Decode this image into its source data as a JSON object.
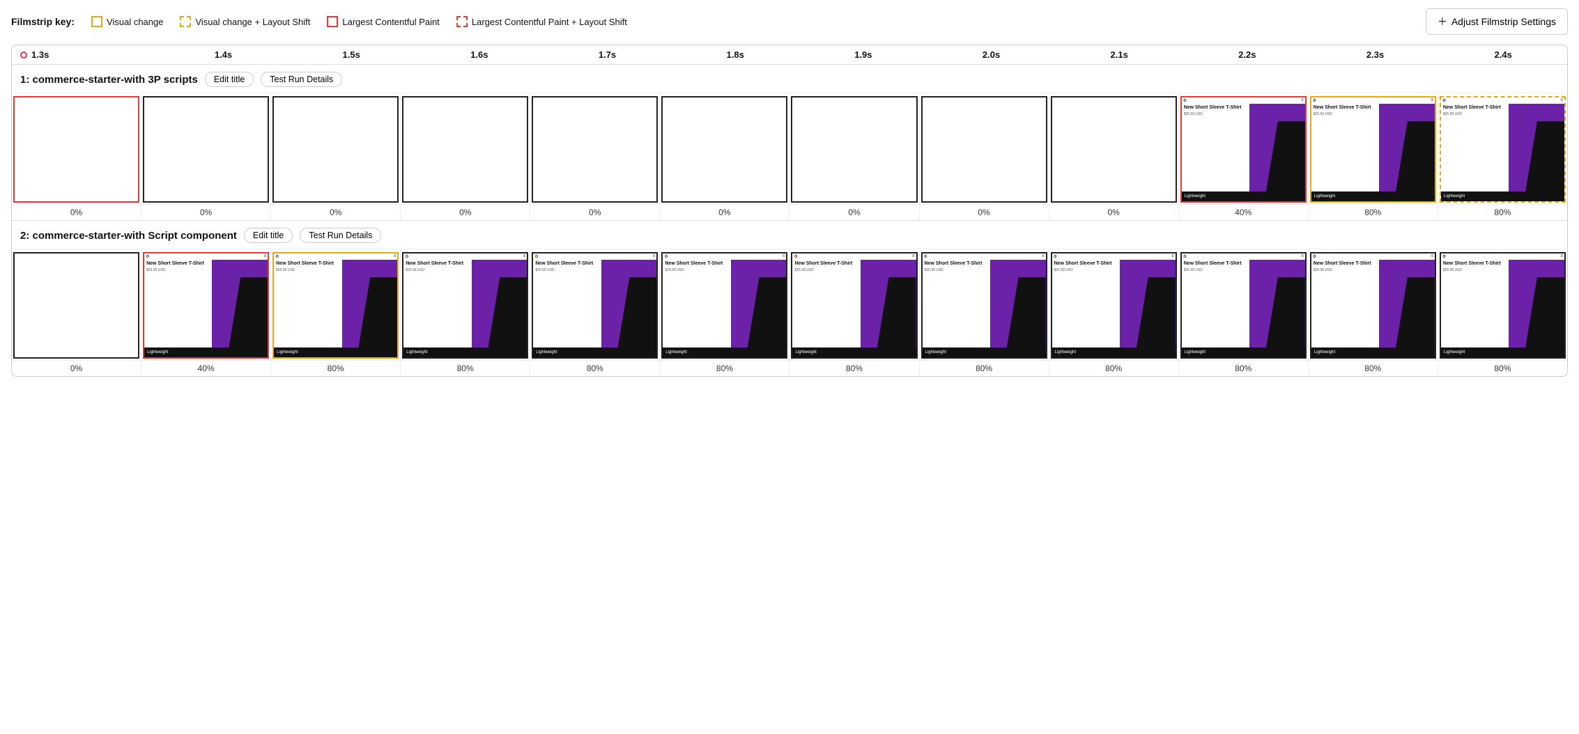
{
  "legend": {
    "label": "Filmstrip key:",
    "items": [
      {
        "id": "visual-change",
        "type": "yellow-solid",
        "text": "Visual change"
      },
      {
        "id": "visual-change-layout",
        "type": "yellow-dashed",
        "text": "Visual change + Layout Shift"
      },
      {
        "id": "lcp",
        "type": "red-solid",
        "text": "Largest Contentful Paint"
      },
      {
        "id": "lcp-layout",
        "type": "red-dashed",
        "text": "Largest Contentful Paint + Layout Shift"
      }
    ],
    "settings_btn": "Adjust Filmstrip Settings"
  },
  "timeline": {
    "times": [
      "1.3s",
      "1.4s",
      "1.5s",
      "1.6s",
      "1.7s",
      "1.8s",
      "1.9s",
      "2.0s",
      "2.1s",
      "2.2s",
      "2.3s",
      "2.4s"
    ]
  },
  "rows": [
    {
      "id": "row1",
      "title": "1: commerce-starter-with 3P scripts",
      "edit_btn": "Edit title",
      "details_btn": "Test Run Details",
      "frames": [
        {
          "border": "red-solid",
          "has_content": false,
          "pct": "0%"
        },
        {
          "border": "plain",
          "has_content": false,
          "pct": "0%"
        },
        {
          "border": "plain",
          "has_content": false,
          "pct": "0%"
        },
        {
          "border": "plain",
          "has_content": false,
          "pct": "0%"
        },
        {
          "border": "plain",
          "has_content": false,
          "pct": "0%"
        },
        {
          "border": "plain",
          "has_content": false,
          "pct": "0%"
        },
        {
          "border": "plain",
          "has_content": false,
          "pct": "0%"
        },
        {
          "border": "plain",
          "has_content": false,
          "pct": "0%"
        },
        {
          "border": "plain",
          "has_content": false,
          "pct": "0%"
        },
        {
          "border": "red-solid",
          "has_content": true,
          "pct": "40%"
        },
        {
          "border": "yellow-solid",
          "has_content": true,
          "pct": "80%"
        },
        {
          "border": "yellow-dashed",
          "has_content": true,
          "pct": "80%"
        }
      ]
    },
    {
      "id": "row2",
      "title": "2: commerce-starter-with Script component",
      "edit_btn": "Edit title",
      "details_btn": "Test Run Details",
      "frames": [
        {
          "border": "plain",
          "has_content": false,
          "pct": "0%"
        },
        {
          "border": "red-solid",
          "has_content": true,
          "pct": "40%"
        },
        {
          "border": "yellow-solid",
          "has_content": true,
          "pct": "80%"
        },
        {
          "border": "plain",
          "has_content": true,
          "pct": "80%"
        },
        {
          "border": "plain",
          "has_content": true,
          "pct": "80%"
        },
        {
          "border": "plain",
          "has_content": true,
          "pct": "80%"
        },
        {
          "border": "plain",
          "has_content": true,
          "pct": "80%"
        },
        {
          "border": "plain",
          "has_content": true,
          "pct": "80%"
        },
        {
          "border": "plain",
          "has_content": true,
          "pct": "80%"
        },
        {
          "border": "plain",
          "has_content": true,
          "pct": "80%"
        },
        {
          "border": "plain",
          "has_content": true,
          "pct": "80%"
        },
        {
          "border": "plain",
          "has_content": true,
          "pct": "80%"
        }
      ]
    }
  ]
}
